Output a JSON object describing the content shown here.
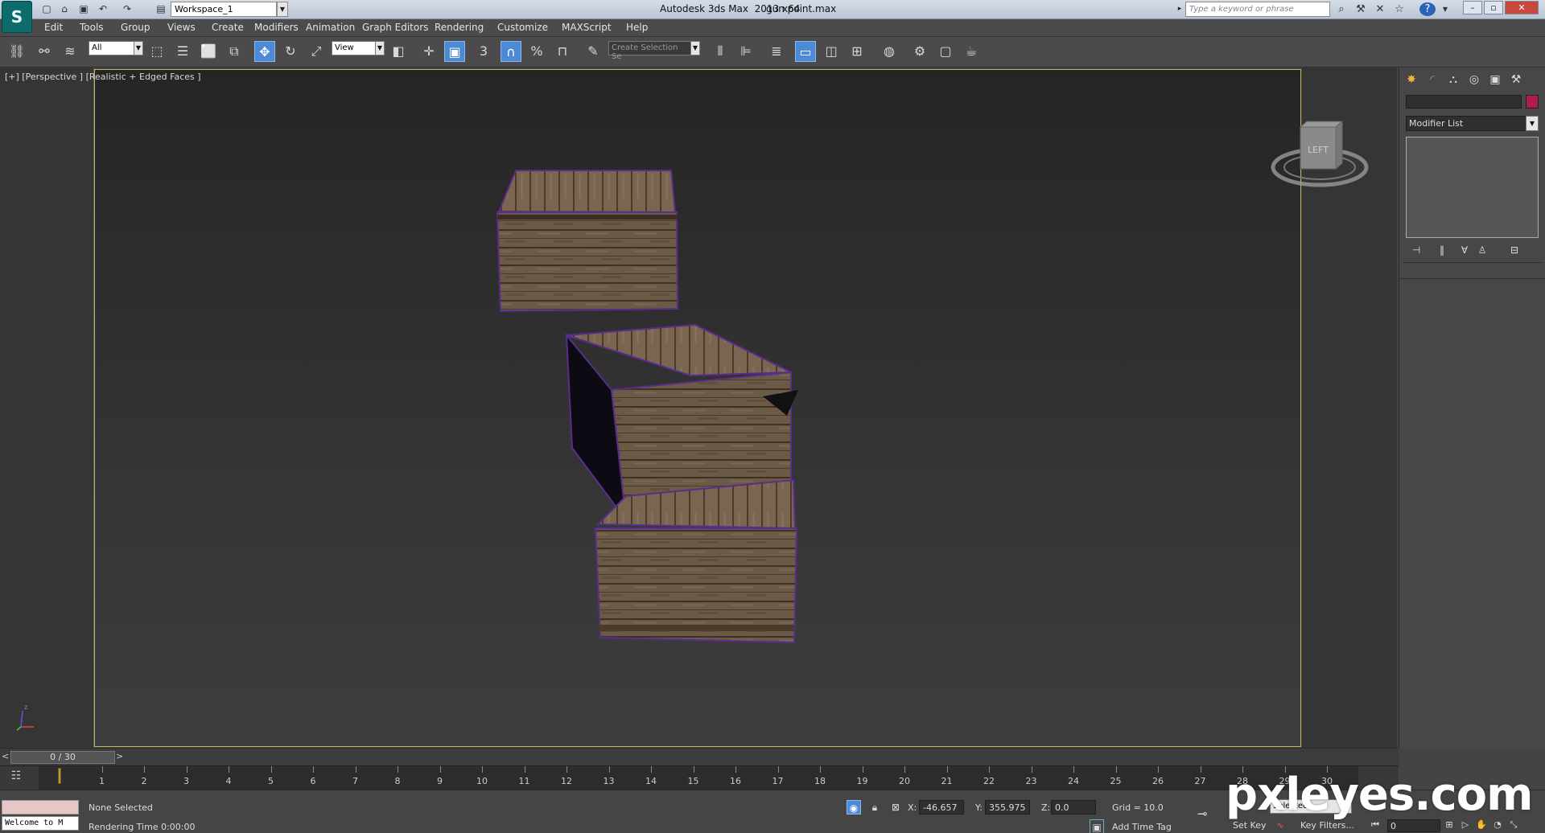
{
  "titlebar": {
    "workspace": "Workspace_1",
    "title": "Autodesk 3ds Max  2013 x64",
    "file": "gun point.max",
    "search_placeholder": "Type a keyword or phrase",
    "help_glyph": "?"
  },
  "menu": [
    "Edit",
    "Tools",
    "Group",
    "Views",
    "Create",
    "Modifiers",
    "Animation",
    "Graph Editors",
    "Rendering",
    "Customize",
    "MAXScript",
    "Help"
  ],
  "toolbar": {
    "selection_filter": "All",
    "ref_coord": "View",
    "snap_angle_label": "3",
    "selection_set_placeholder": "Create Selection Se"
  },
  "viewport": {
    "label": "[+] [Perspective ] [Realistic + Edged Faces ]",
    "viewcube_face": "LEFT",
    "axis_labels": [
      "x",
      "y",
      "z"
    ]
  },
  "command_panel": {
    "modifier_list": "Modifier List",
    "object_color": "#b01b56"
  },
  "timeline": {
    "frame_display": "0 / 30",
    "prev_glyph": "<",
    "next_glyph": ">",
    "ticks": [
      "1",
      "2",
      "3",
      "4",
      "5",
      "6",
      "7",
      "8",
      "9",
      "10",
      "11",
      "12",
      "13",
      "14",
      "15",
      "16",
      "17",
      "18",
      "19",
      "20",
      "21",
      "22",
      "23",
      "24",
      "25",
      "26",
      "27",
      "28",
      "29",
      "30"
    ]
  },
  "status": {
    "selection": "None Selected",
    "prompt": "Rendering Time  0:00:00",
    "welcome": "Welcome to M",
    "x_label": "X:",
    "x": "-46.657",
    "y_label": "Y:",
    "y": "355.975",
    "z_label": "Z:",
    "z": "0.0",
    "grid": "Grid = 10.0",
    "add_time_tag": "Add Time Tag",
    "set_key": "Set Key",
    "key_filters": "Key Filters...",
    "selected_set": "Selected",
    "frame": "0"
  },
  "watermark": "pxleyes.com",
  "colors": {
    "accent": "#4d8ad6",
    "viewport_border": "#c7b15a",
    "crate_outline": "#5a2d8c"
  }
}
